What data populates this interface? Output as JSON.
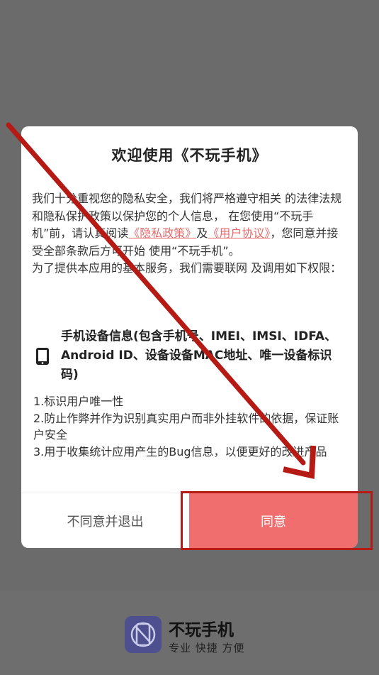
{
  "dialog": {
    "title": "欢迎使用《不玩手机》",
    "intro_1": "我们十分重视您的隐私安全，我们将严格遵守相关 的法律法规和隐私保护政策以保护您的个人信息， 在您使用“不玩手机”前，请认真阅读",
    "privacy_link": "《隐私政策》",
    "and": "及",
    "user_agreement_link": "《用户协议》",
    "intro_2": "，您同意并接受全部条款后方可开始 使用“不玩手机”。",
    "permission_intro": " 为了提供本应用的基本服务，我们需要联网 及调用如下权限：",
    "permission_icon": "smartphone-icon",
    "permission_title": "手机设备信息(包含手机号、IMEI、IMSI、IDFA、Android ID、设备设备MAC地址、唯一设备标识码)",
    "reasons": [
      "1.标识用户唯一性",
      "2.防止作弊并作为识别真实用户而非外挂软件的依据，保证账户安全",
      "3.用于收集统计应用产生的Bug信息，以便更好的改进产品"
    ],
    "decline_label": "不同意并退出",
    "agree_label": "同意"
  },
  "footer": {
    "app_name": "不玩手机",
    "slogan": "专业 快捷 方便",
    "logo_icon": "no-phone-icon"
  },
  "colors": {
    "accent": "#f06e6e",
    "link": "#e46a6a",
    "annotation": "#b51a15",
    "overlay": "#6b6b6b"
  }
}
